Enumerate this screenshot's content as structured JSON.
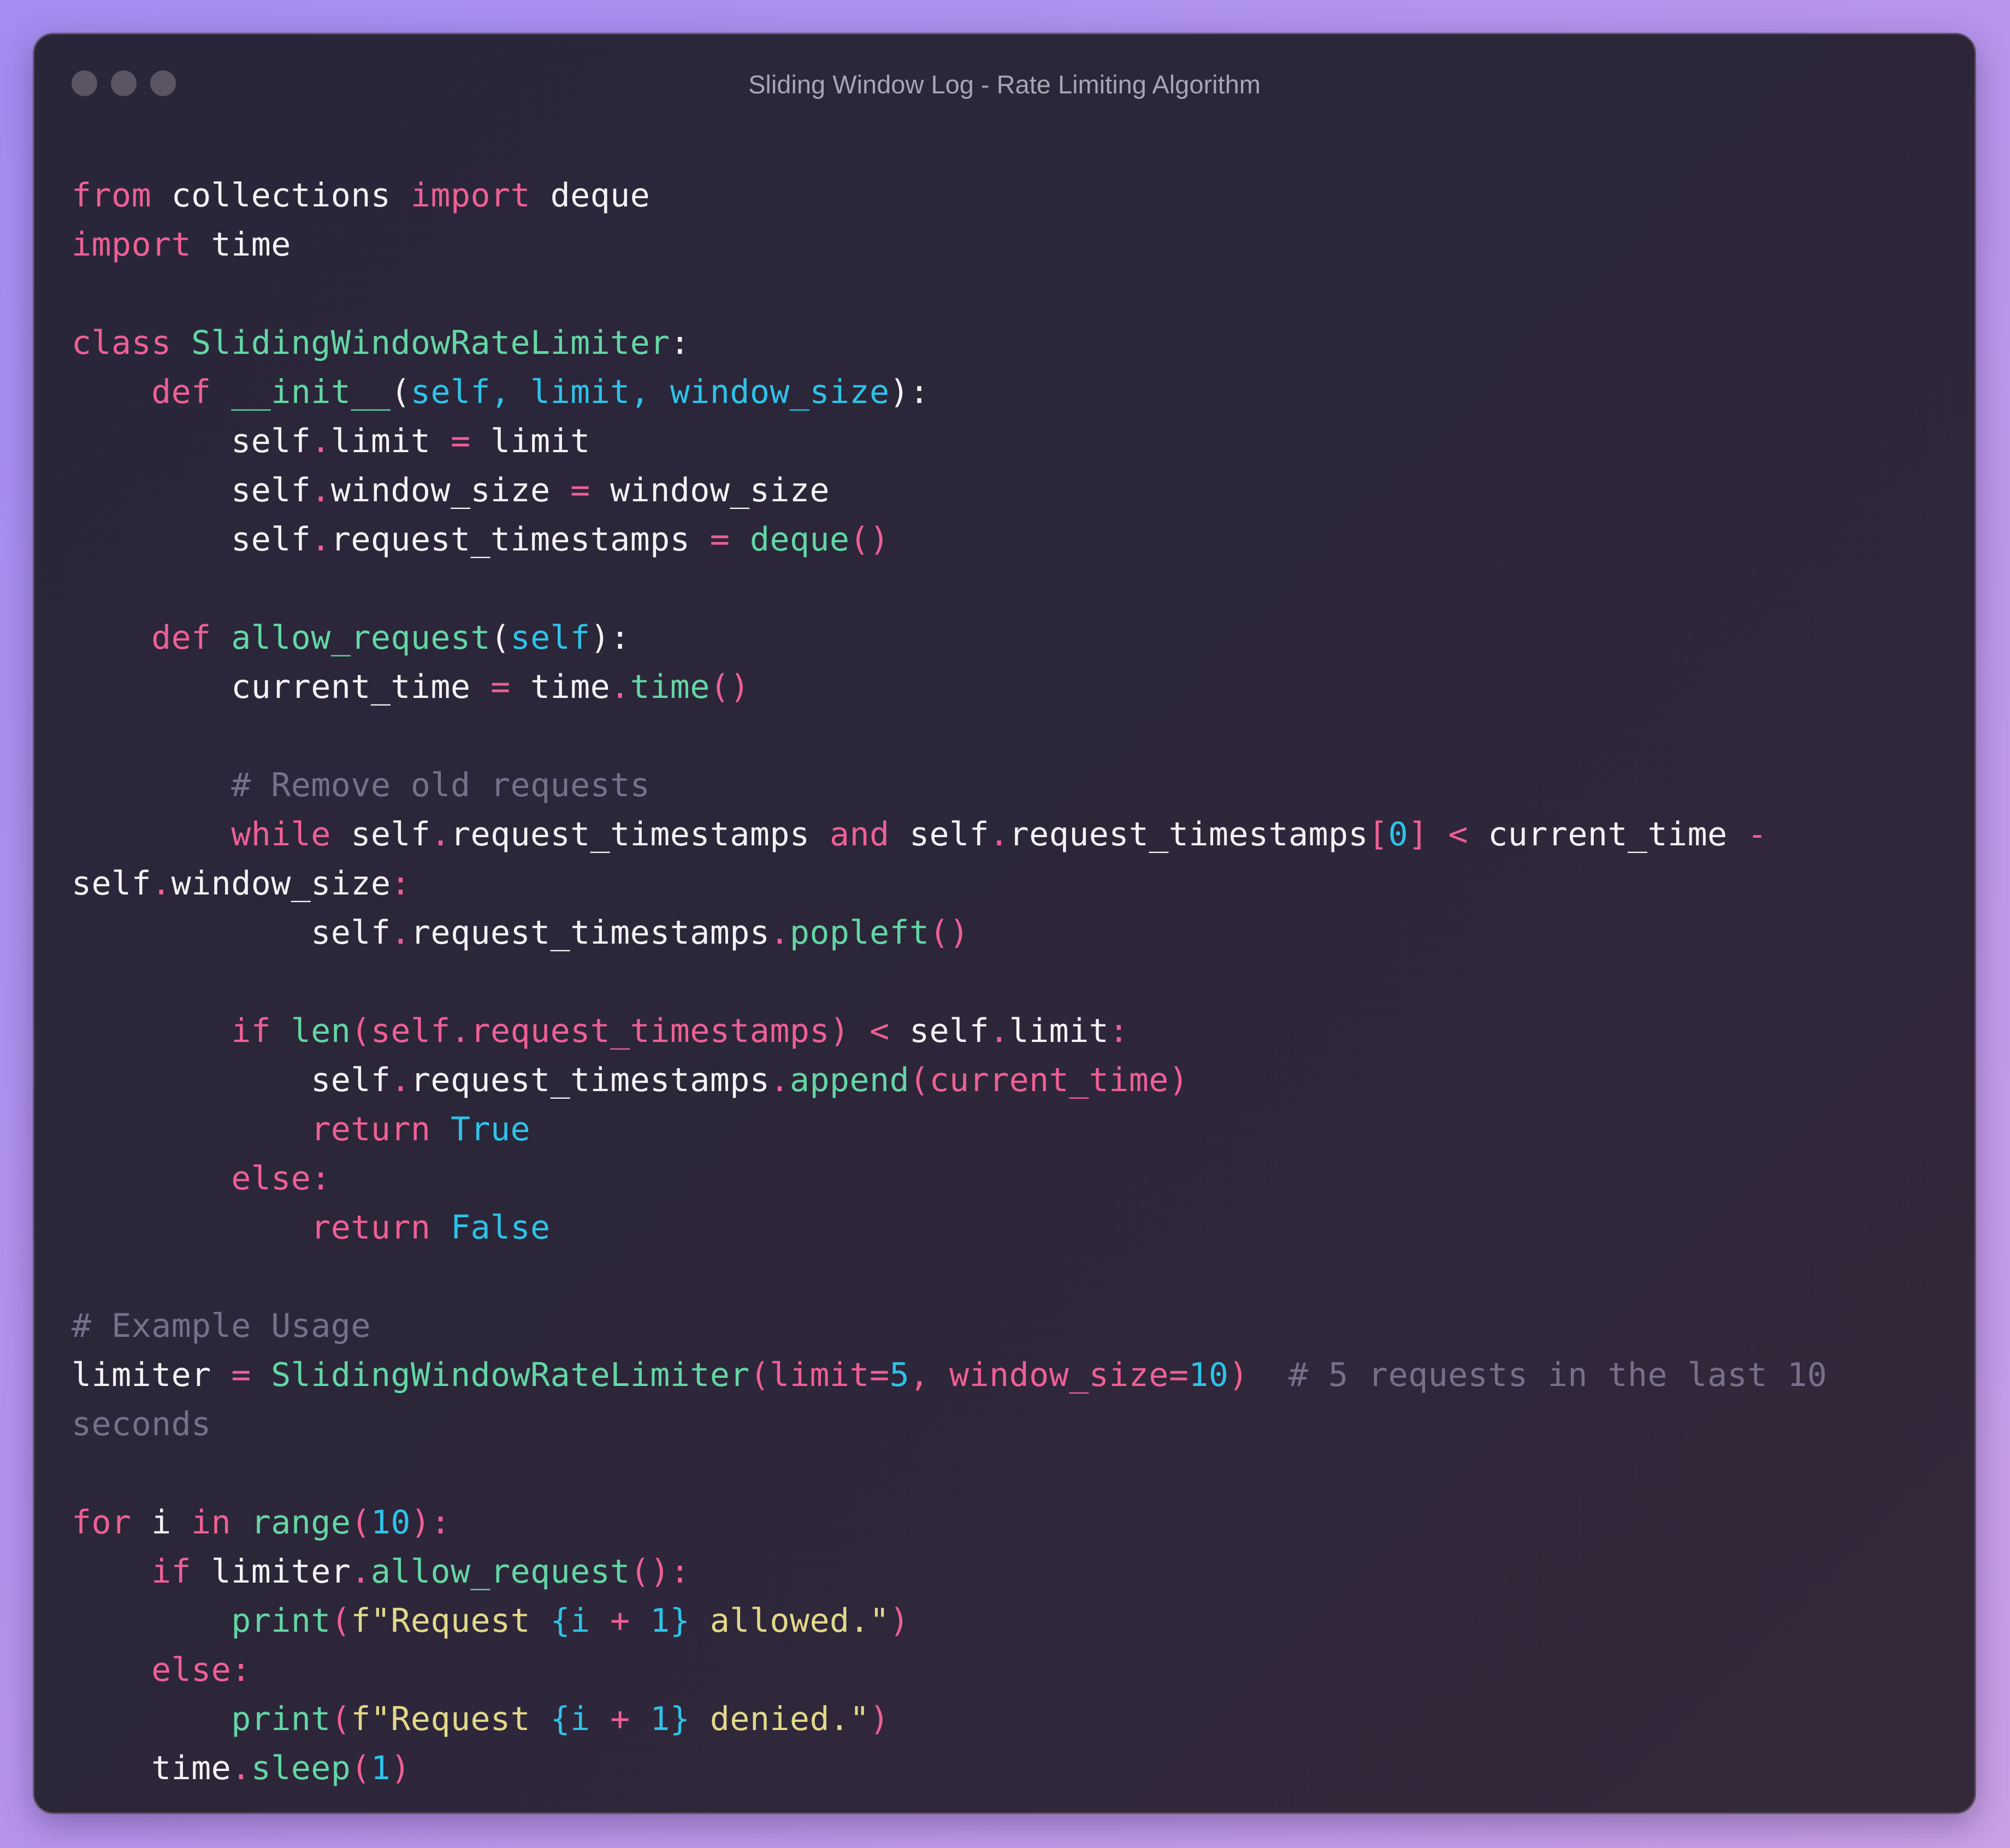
{
  "window": {
    "title": "Sliding Window Log - Rate Limiting Algorithm"
  },
  "theme": {
    "keyword": "#ee5f96",
    "name": "#f4f2f6",
    "function": "#63d6a4",
    "param": "#2ec2e8",
    "comment": "#77708a",
    "string": "#e2d98a"
  },
  "code_lines": [
    [
      [
        "kw",
        "from"
      ],
      [
        "nm",
        " collections "
      ],
      [
        "kw",
        "import"
      ],
      [
        "nm",
        " deque"
      ]
    ],
    [
      [
        "kw",
        "import"
      ],
      [
        "nm",
        " time"
      ]
    ],
    [],
    [
      [
        "kw",
        "class"
      ],
      [
        "nm",
        " "
      ],
      [
        "fn",
        "SlidingWindowRateLimiter"
      ],
      [
        "nm",
        ":"
      ]
    ],
    [
      [
        "nm",
        "    "
      ],
      [
        "kw",
        "def"
      ],
      [
        "nm",
        " "
      ],
      [
        "fn",
        "__init__"
      ],
      [
        "nm",
        "("
      ],
      [
        "pa",
        "self, limit, window_size"
      ],
      [
        "nm",
        "):"
      ]
    ],
    [
      [
        "nm",
        "        self"
      ],
      [
        "kw",
        "."
      ],
      [
        "nm",
        "limit "
      ],
      [
        "kw",
        "="
      ],
      [
        "nm",
        " limit"
      ]
    ],
    [
      [
        "nm",
        "        self"
      ],
      [
        "kw",
        "."
      ],
      [
        "nm",
        "window_size "
      ],
      [
        "kw",
        "="
      ],
      [
        "nm",
        " window_size"
      ]
    ],
    [
      [
        "nm",
        "        self"
      ],
      [
        "kw",
        "."
      ],
      [
        "nm",
        "request_timestamps "
      ],
      [
        "kw",
        "="
      ],
      [
        "nm",
        " "
      ],
      [
        "fn",
        "deque"
      ],
      [
        "kw",
        "()"
      ]
    ],
    [],
    [
      [
        "nm",
        "    "
      ],
      [
        "kw",
        "def"
      ],
      [
        "nm",
        " "
      ],
      [
        "fn",
        "allow_request"
      ],
      [
        "nm",
        "("
      ],
      [
        "pa",
        "self"
      ],
      [
        "nm",
        "):"
      ]
    ],
    [
      [
        "nm",
        "        current_time "
      ],
      [
        "kw",
        "="
      ],
      [
        "nm",
        " time"
      ],
      [
        "kw",
        "."
      ],
      [
        "fn",
        "time"
      ],
      [
        "kw",
        "()"
      ]
    ],
    [],
    [
      [
        "cm",
        "        # Remove old requests"
      ]
    ],
    [
      [
        "nm",
        "        "
      ],
      [
        "kw",
        "while"
      ],
      [
        "nm",
        " self"
      ],
      [
        "kw",
        "."
      ],
      [
        "nm",
        "request_timestamps "
      ],
      [
        "kw",
        "and"
      ],
      [
        "nm",
        " self"
      ],
      [
        "kw",
        "."
      ],
      [
        "nm",
        "request_timestamps"
      ],
      [
        "kw",
        "["
      ],
      [
        "pa",
        "0"
      ],
      [
        "kw",
        "]"
      ],
      [
        "nm",
        " "
      ],
      [
        "kw",
        "<"
      ],
      [
        "nm",
        " current_time "
      ],
      [
        "kw",
        "-"
      ]
    ],
    [
      [
        "nm",
        "self"
      ],
      [
        "kw",
        "."
      ],
      [
        "nm",
        "window_size"
      ],
      [
        "kw",
        ":"
      ]
    ],
    [
      [
        "nm",
        "            self"
      ],
      [
        "kw",
        "."
      ],
      [
        "nm",
        "request_timestamps"
      ],
      [
        "kw",
        "."
      ],
      [
        "fn",
        "popleft"
      ],
      [
        "kw",
        "()"
      ]
    ],
    [],
    [
      [
        "nm",
        "        "
      ],
      [
        "kw",
        "if"
      ],
      [
        "nm",
        " "
      ],
      [
        "fn",
        "len"
      ],
      [
        "kw",
        "(self.request_timestamps)"
      ],
      [
        "nm",
        " "
      ],
      [
        "kw",
        "<"
      ],
      [
        "nm",
        " self"
      ],
      [
        "kw",
        "."
      ],
      [
        "nm",
        "limit"
      ],
      [
        "kw",
        ":"
      ]
    ],
    [
      [
        "nm",
        "            self"
      ],
      [
        "kw",
        "."
      ],
      [
        "nm",
        "request_timestamps"
      ],
      [
        "kw",
        "."
      ],
      [
        "fn",
        "append"
      ],
      [
        "kw",
        "(current_time)"
      ]
    ],
    [
      [
        "nm",
        "            "
      ],
      [
        "kw",
        "return"
      ],
      [
        "nm",
        " "
      ],
      [
        "pa",
        "True"
      ]
    ],
    [
      [
        "nm",
        "        "
      ],
      [
        "kw",
        "else:"
      ]
    ],
    [
      [
        "nm",
        "            "
      ],
      [
        "kw",
        "return"
      ],
      [
        "nm",
        " "
      ],
      [
        "pa",
        "False"
      ]
    ],
    [],
    [
      [
        "cm",
        "# Example Usage"
      ]
    ],
    [
      [
        "nm",
        "limiter "
      ],
      [
        "kw",
        "="
      ],
      [
        "nm",
        " "
      ],
      [
        "fn",
        "SlidingWindowRateLimiter"
      ],
      [
        "kw",
        "(limit="
      ],
      [
        "pa",
        "5"
      ],
      [
        "kw",
        ", window_size="
      ],
      [
        "pa",
        "10"
      ],
      [
        "kw",
        ")"
      ],
      [
        "cm",
        "  # 5 requests in the last 10"
      ]
    ],
    [
      [
        "cm",
        "seconds"
      ]
    ],
    [],
    [
      [
        "kw",
        "for"
      ],
      [
        "nm",
        " i "
      ],
      [
        "kw",
        "in"
      ],
      [
        "nm",
        " "
      ],
      [
        "fn",
        "range"
      ],
      [
        "kw",
        "("
      ],
      [
        "pa",
        "10"
      ],
      [
        "kw",
        "):"
      ]
    ],
    [
      [
        "nm",
        "    "
      ],
      [
        "kw",
        "if"
      ],
      [
        "nm",
        " limiter"
      ],
      [
        "kw",
        "."
      ],
      [
        "fn",
        "allow_request"
      ],
      [
        "kw",
        "():"
      ]
    ],
    [
      [
        "nm",
        "        "
      ],
      [
        "fn",
        "print"
      ],
      [
        "kw",
        "("
      ],
      [
        "st",
        "f\"Request "
      ],
      [
        "pa",
        "{i "
      ],
      [
        "kw",
        "+"
      ],
      [
        "pa",
        " 1}"
      ],
      [
        "st",
        " allowed.\""
      ],
      [
        "kw",
        ")"
      ]
    ],
    [
      [
        "nm",
        "    "
      ],
      [
        "kw",
        "else:"
      ]
    ],
    [
      [
        "nm",
        "        "
      ],
      [
        "fn",
        "print"
      ],
      [
        "kw",
        "("
      ],
      [
        "st",
        "f\"Request "
      ],
      [
        "pa",
        "{i "
      ],
      [
        "kw",
        "+"
      ],
      [
        "pa",
        " 1}"
      ],
      [
        "st",
        " denied.\""
      ],
      [
        "kw",
        ")"
      ]
    ],
    [
      [
        "nm",
        "    time"
      ],
      [
        "kw",
        "."
      ],
      [
        "fn",
        "sleep"
      ],
      [
        "kw",
        "("
      ],
      [
        "pa",
        "1"
      ],
      [
        "kw",
        ")"
      ]
    ]
  ]
}
